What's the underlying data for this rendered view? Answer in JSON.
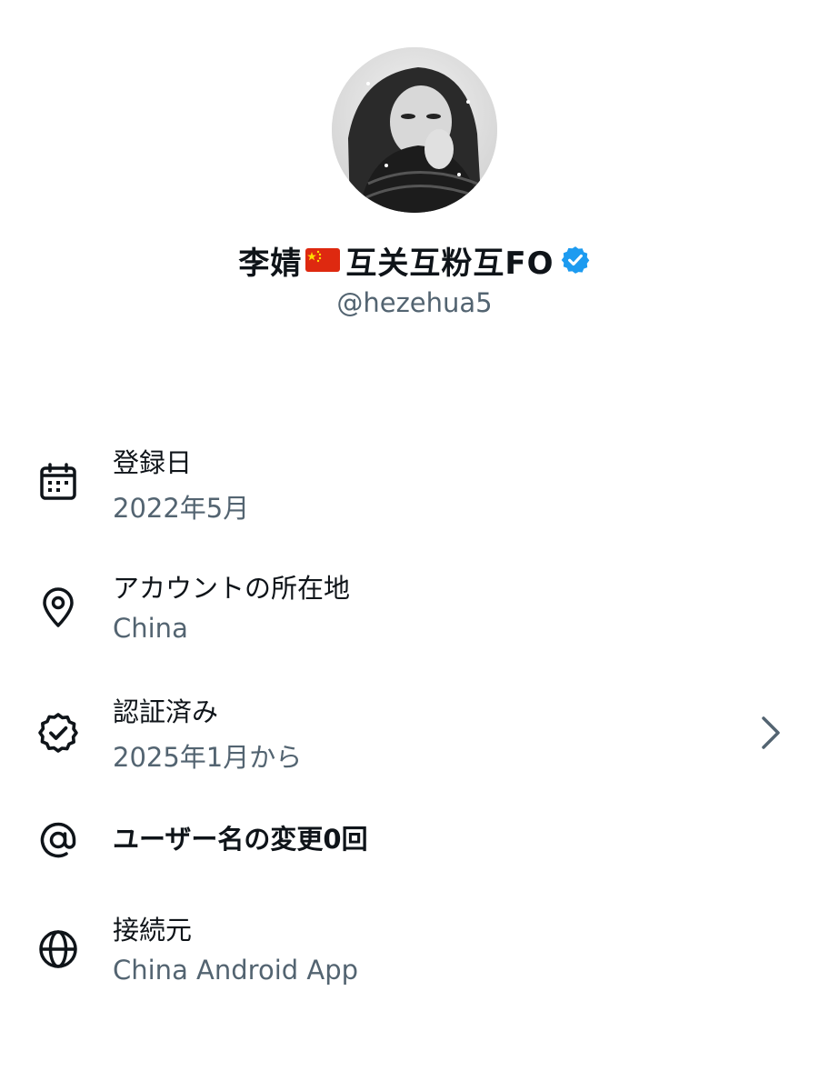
{
  "profile": {
    "display_name_part1": "李婧",
    "display_name_part2": "互关互粉互FO",
    "flag_icon": "china-flag-icon",
    "verified_icon": "verified-badge-icon",
    "handle": "@hezehua5"
  },
  "info": {
    "joined": {
      "icon": "calendar-icon",
      "title": "登録日",
      "value": "2022年5月"
    },
    "location": {
      "icon": "location-pin-icon",
      "title": "アカウントの所在地",
      "value": "China"
    },
    "verified": {
      "icon": "verified-outline-icon",
      "title": "認証済み",
      "value": "2025年1月から",
      "chevron": "chevron-right-icon"
    },
    "username_changes": {
      "icon": "at-sign-icon",
      "title": "ユーザー名の変更0回"
    },
    "connected_via": {
      "icon": "globe-icon",
      "title": "接続元",
      "value": "China Android App"
    }
  },
  "colors": {
    "text_primary": "#0f1419",
    "text_secondary": "#536471",
    "verified_blue": "#1d9bf0",
    "flag_red": "#de2910",
    "flag_yellow": "#ffde00"
  }
}
